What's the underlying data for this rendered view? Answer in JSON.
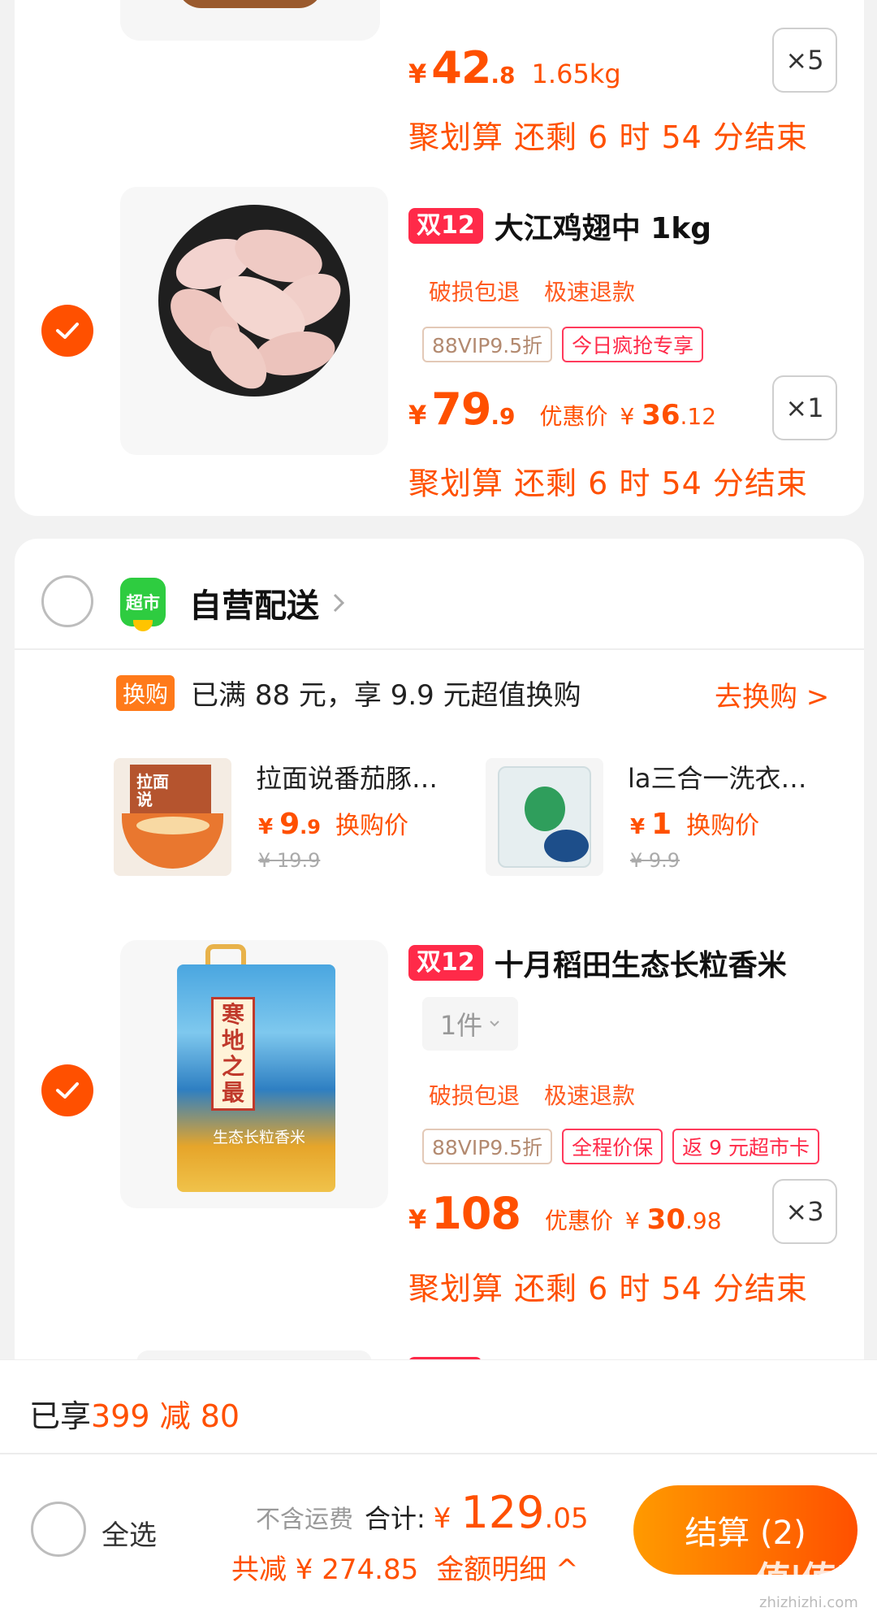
{
  "item_top": {
    "price_yen": "¥",
    "price_int": "42",
    "price_dec": ".8",
    "weight": "1.65kg",
    "qty": "×5",
    "countdown": "聚划算 还剩 6 时 54 分结束"
  },
  "item_wings": {
    "badge": "双12",
    "title": "大江鸡翅中 1kg",
    "services": [
      "破损包退",
      "极速退款"
    ],
    "tags": [
      "88VIP9.5折",
      "今日疯抢专享"
    ],
    "price_yen": "¥",
    "price_int": "79",
    "price_dec": ".9",
    "youhui_label": "优惠价",
    "youhui_yen": "¥",
    "youhui_int": "36",
    "youhui_dec": ".12",
    "qty": "×1",
    "countdown": "聚划算 还剩 6 时 54 分结束"
  },
  "store": {
    "logo": "超市",
    "name": "自营配送",
    "exchange_tag": "换购",
    "exchange_text": "已满 88 元，享 9.9 元超值换购",
    "exchange_link": "去换购 >",
    "exchange_items": [
      {
        "name": "拉面说番茄豚…",
        "price_yen": "¥",
        "price_int": "9",
        "price_dec": ".9",
        "label": "换购价",
        "orig": "¥ 19.9"
      },
      {
        "name": "la三合一洗衣…",
        "price_yen": "¥",
        "price_int": "1",
        "price_dec": "",
        "label": "换购价",
        "orig": "¥ 9.9"
      }
    ],
    "noodle_img_text": "拉面说"
  },
  "item_rice": {
    "badge": "双12",
    "title": "十月稻田生态长粒香米",
    "spec": "1件",
    "services": [
      "破损包退",
      "极速退款"
    ],
    "tags": [
      "88VIP9.5折",
      "全程价保",
      "返 9 元超市卡"
    ],
    "price_yen": "¥",
    "price_int": "108",
    "price_dec": "",
    "youhui_label": "优惠价",
    "youhui_yen": "¥",
    "youhui_int": "30",
    "youhui_dec": ".98",
    "qty": "×3",
    "countdown": "聚划算 还剩 6 时 54 分结束",
    "bag_title": "寒地之最",
    "bag_sub": "生态长粒香米"
  },
  "footer": {
    "promo_prefix": "已享",
    "promo_value": "399 减 80",
    "select_all": "全选",
    "no_shipping": "不含运费",
    "total_label": "合计:",
    "total_yen": "¥",
    "total_int": "129",
    "total_dec": ".05",
    "saved": "共减 ¥ 274.85",
    "detail": "金额明细 ^",
    "checkout": "结算 (2)",
    "watermark": "值|值|值",
    "watermark_sub": "zhizhizhi.com"
  }
}
